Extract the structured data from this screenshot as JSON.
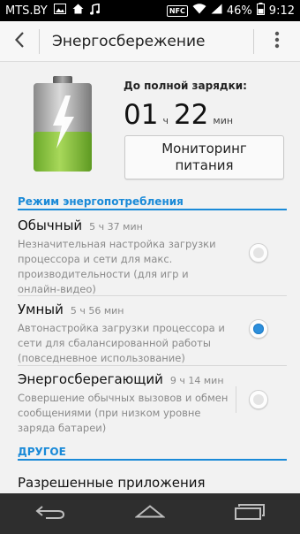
{
  "status_bar": {
    "carrier": "MTS.BY",
    "nfc": "NFC",
    "battery_percent": "46%",
    "time": "9:12",
    "icons": [
      "image-icon",
      "home-icon",
      "music-icon",
      "nfc-icon",
      "wifi-icon",
      "signal-icon",
      "battery-icon"
    ]
  },
  "action_bar": {
    "title": "Энергосбережение"
  },
  "summary": {
    "charge_label": "До полной зарядки:",
    "hours": "01",
    "hours_unit": "ч",
    "minutes": "22",
    "minutes_unit": "мин",
    "battery_level": 0.45,
    "monitor_button": [
      "Мониторинг",
      "питания"
    ]
  },
  "sections": {
    "power_mode": "Режим энергопотребления",
    "other": "ДРУГОЕ"
  },
  "modes": [
    {
      "name": "Обычный",
      "time": "5 ч 37 мин",
      "description": "Незначительная настройка загрузки процессора и сети для макс. производительности (для игр и онлайн-видео)",
      "selected": false
    },
    {
      "name": "Умный",
      "time": "5 ч 56 мин",
      "description": "Автонастройка загрузки процессора и сети для сбалансированной работы (повседневное использование)",
      "selected": true
    },
    {
      "name": "Энергосберегающий",
      "time": "9 ч 14 мин",
      "description": "Совершение обычных вызовов и обмен сообщениями (при низком уровне заряда батареи)",
      "selected": false
    }
  ],
  "other_items": {
    "allowed_apps": "Разрешенные приложения"
  },
  "colors": {
    "accent": "#1a8ad8",
    "battery_green": "#8cc63f",
    "status_bar": "#000000",
    "nav_bar": "#2e2e2e"
  }
}
